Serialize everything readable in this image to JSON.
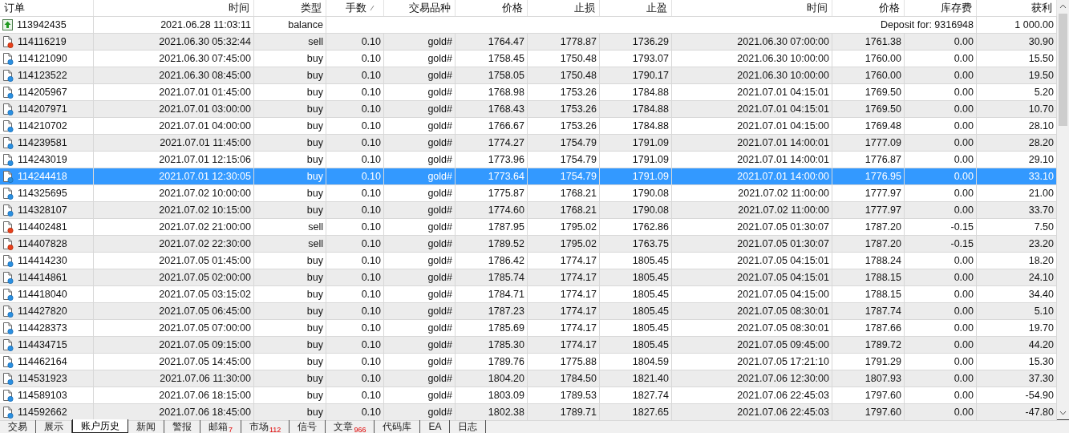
{
  "table": {
    "columns": [
      {
        "label": "订单",
        "sorted": false
      },
      {
        "label": "时间",
        "sorted": false
      },
      {
        "label": "类型",
        "sorted": false
      },
      {
        "label": "手数",
        "sorted": true
      },
      {
        "label": "交易品种",
        "sorted": false
      },
      {
        "label": "价格",
        "sorted": false
      },
      {
        "label": "止损",
        "sorted": false
      },
      {
        "label": "止盈",
        "sorted": false
      },
      {
        "label": "时间",
        "sorted": false
      },
      {
        "label": "价格",
        "sorted": false
      },
      {
        "label": "库存费",
        "sorted": false
      },
      {
        "label": "获利",
        "sorted": false
      }
    ],
    "rows": [
      {
        "kind": "balance",
        "selected": false,
        "cells": [
          "113942435",
          "2021.06.28 11:03:11",
          "balance",
          "",
          "",
          "",
          "",
          "",
          "",
          "",
          "Deposit for: 9316948",
          "1 000.00"
        ]
      },
      {
        "kind": "sell",
        "selected": false,
        "cells": [
          "114116219",
          "2021.06.30 05:32:44",
          "sell",
          "0.10",
          "gold#",
          "1764.47",
          "1778.87",
          "1736.29",
          "2021.06.30 07:00:00",
          "1761.38",
          "0.00",
          "30.90"
        ]
      },
      {
        "kind": "buy",
        "selected": false,
        "cells": [
          "114121090",
          "2021.06.30 07:45:00",
          "buy",
          "0.10",
          "gold#",
          "1758.45",
          "1750.48",
          "1793.07",
          "2021.06.30 10:00:00",
          "1760.00",
          "0.00",
          "15.50"
        ]
      },
      {
        "kind": "buy",
        "selected": false,
        "cells": [
          "114123522",
          "2021.06.30 08:45:00",
          "buy",
          "0.10",
          "gold#",
          "1758.05",
          "1750.48",
          "1790.17",
          "2021.06.30 10:00:00",
          "1760.00",
          "0.00",
          "19.50"
        ]
      },
      {
        "kind": "buy",
        "selected": false,
        "cells": [
          "114205967",
          "2021.07.01 01:45:00",
          "buy",
          "0.10",
          "gold#",
          "1768.98",
          "1753.26",
          "1784.88",
          "2021.07.01 04:15:01",
          "1769.50",
          "0.00",
          "5.20"
        ]
      },
      {
        "kind": "buy",
        "selected": false,
        "cells": [
          "114207971",
          "2021.07.01 03:00:00",
          "buy",
          "0.10",
          "gold#",
          "1768.43",
          "1753.26",
          "1784.88",
          "2021.07.01 04:15:01",
          "1769.50",
          "0.00",
          "10.70"
        ]
      },
      {
        "kind": "buy",
        "selected": false,
        "cells": [
          "114210702",
          "2021.07.01 04:00:00",
          "buy",
          "0.10",
          "gold#",
          "1766.67",
          "1753.26",
          "1784.88",
          "2021.07.01 04:15:00",
          "1769.48",
          "0.00",
          "28.10"
        ]
      },
      {
        "kind": "buy",
        "selected": false,
        "cells": [
          "114239581",
          "2021.07.01 11:45:00",
          "buy",
          "0.10",
          "gold#",
          "1774.27",
          "1754.79",
          "1791.09",
          "2021.07.01 14:00:01",
          "1777.09",
          "0.00",
          "28.20"
        ]
      },
      {
        "kind": "buy",
        "selected": false,
        "cells": [
          "114243019",
          "2021.07.01 12:15:06",
          "buy",
          "0.10",
          "gold#",
          "1773.96",
          "1754.79",
          "1791.09",
          "2021.07.01 14:00:01",
          "1776.87",
          "0.00",
          "29.10"
        ]
      },
      {
        "kind": "buy",
        "selected": true,
        "cells": [
          "114244418",
          "2021.07.01 12:30:05",
          "buy",
          "0.10",
          "gold#",
          "1773.64",
          "1754.79",
          "1791.09",
          "2021.07.01 14:00:00",
          "1776.95",
          "0.00",
          "33.10"
        ]
      },
      {
        "kind": "buy",
        "selected": false,
        "cells": [
          "114325695",
          "2021.07.02 10:00:00",
          "buy",
          "0.10",
          "gold#",
          "1775.87",
          "1768.21",
          "1790.08",
          "2021.07.02 11:00:00",
          "1777.97",
          "0.00",
          "21.00"
        ]
      },
      {
        "kind": "buy",
        "selected": false,
        "cells": [
          "114328107",
          "2021.07.02 10:15:00",
          "buy",
          "0.10",
          "gold#",
          "1774.60",
          "1768.21",
          "1790.08",
          "2021.07.02 11:00:00",
          "1777.97",
          "0.00",
          "33.70"
        ]
      },
      {
        "kind": "sell",
        "selected": false,
        "cells": [
          "114402481",
          "2021.07.02 21:00:00",
          "sell",
          "0.10",
          "gold#",
          "1787.95",
          "1795.02",
          "1762.86",
          "2021.07.05 01:30:07",
          "1787.20",
          "-0.15",
          "7.50"
        ]
      },
      {
        "kind": "sell",
        "selected": false,
        "cells": [
          "114407828",
          "2021.07.02 22:30:00",
          "sell",
          "0.10",
          "gold#",
          "1789.52",
          "1795.02",
          "1763.75",
          "2021.07.05 01:30:07",
          "1787.20",
          "-0.15",
          "23.20"
        ]
      },
      {
        "kind": "buy",
        "selected": false,
        "cells": [
          "114414230",
          "2021.07.05 01:45:00",
          "buy",
          "0.10",
          "gold#",
          "1786.42",
          "1774.17",
          "1805.45",
          "2021.07.05 04:15:01",
          "1788.24",
          "0.00",
          "18.20"
        ]
      },
      {
        "kind": "buy",
        "selected": false,
        "cells": [
          "114414861",
          "2021.07.05 02:00:00",
          "buy",
          "0.10",
          "gold#",
          "1785.74",
          "1774.17",
          "1805.45",
          "2021.07.05 04:15:01",
          "1788.15",
          "0.00",
          "24.10"
        ]
      },
      {
        "kind": "buy",
        "selected": false,
        "cells": [
          "114418040",
          "2021.07.05 03:15:02",
          "buy",
          "0.10",
          "gold#",
          "1784.71",
          "1774.17",
          "1805.45",
          "2021.07.05 04:15:00",
          "1788.15",
          "0.00",
          "34.40"
        ]
      },
      {
        "kind": "buy",
        "selected": false,
        "cells": [
          "114427820",
          "2021.07.05 06:45:00",
          "buy",
          "0.10",
          "gold#",
          "1787.23",
          "1774.17",
          "1805.45",
          "2021.07.05 08:30:01",
          "1787.74",
          "0.00",
          "5.10"
        ]
      },
      {
        "kind": "buy",
        "selected": false,
        "cells": [
          "114428373",
          "2021.07.05 07:00:00",
          "buy",
          "0.10",
          "gold#",
          "1785.69",
          "1774.17",
          "1805.45",
          "2021.07.05 08:30:01",
          "1787.66",
          "0.00",
          "19.70"
        ]
      },
      {
        "kind": "buy",
        "selected": false,
        "cells": [
          "114434715",
          "2021.07.05 09:15:00",
          "buy",
          "0.10",
          "gold#",
          "1785.30",
          "1774.17",
          "1805.45",
          "2021.07.05 09:45:00",
          "1789.72",
          "0.00",
          "44.20"
        ]
      },
      {
        "kind": "buy",
        "selected": false,
        "cells": [
          "114462164",
          "2021.07.05 14:45:00",
          "buy",
          "0.10",
          "gold#",
          "1789.76",
          "1775.88",
          "1804.59",
          "2021.07.05 17:21:10",
          "1791.29",
          "0.00",
          "15.30"
        ]
      },
      {
        "kind": "buy",
        "selected": false,
        "cells": [
          "114531923",
          "2021.07.06 11:30:00",
          "buy",
          "0.10",
          "gold#",
          "1804.20",
          "1784.50",
          "1821.40",
          "2021.07.06 12:30:00",
          "1807.93",
          "0.00",
          "37.30"
        ]
      },
      {
        "kind": "buy",
        "selected": false,
        "cells": [
          "114589103",
          "2021.07.06 18:15:00",
          "buy",
          "0.10",
          "gold#",
          "1803.09",
          "1789.53",
          "1827.74",
          "2021.07.06 22:45:03",
          "1797.60",
          "0.00",
          "-54.90"
        ]
      },
      {
        "kind": "buy",
        "selected": false,
        "cells": [
          "114592662",
          "2021.07.06 18:45:00",
          "buy",
          "0.10",
          "gold#",
          "1802.38",
          "1789.71",
          "1827.65",
          "2021.07.06 22:45:03",
          "1797.60",
          "0.00",
          "-47.80"
        ]
      }
    ]
  },
  "tabs": [
    {
      "label": "交易",
      "selected": false
    },
    {
      "label": "展示",
      "selected": false
    },
    {
      "label": "账户历史",
      "selected": true
    },
    {
      "label": "新闻",
      "selected": false
    },
    {
      "label": "警报",
      "selected": false
    },
    {
      "label": "邮箱",
      "badge": "7",
      "selected": false
    },
    {
      "label": "市场",
      "badge": "112",
      "selected": false
    },
    {
      "label": "信号",
      "selected": false
    },
    {
      "label": "文章",
      "badge": "966",
      "selected": false
    },
    {
      "label": "代码库",
      "selected": false
    },
    {
      "label": "EA",
      "selected": false
    },
    {
      "label": "日志",
      "selected": false
    }
  ]
}
